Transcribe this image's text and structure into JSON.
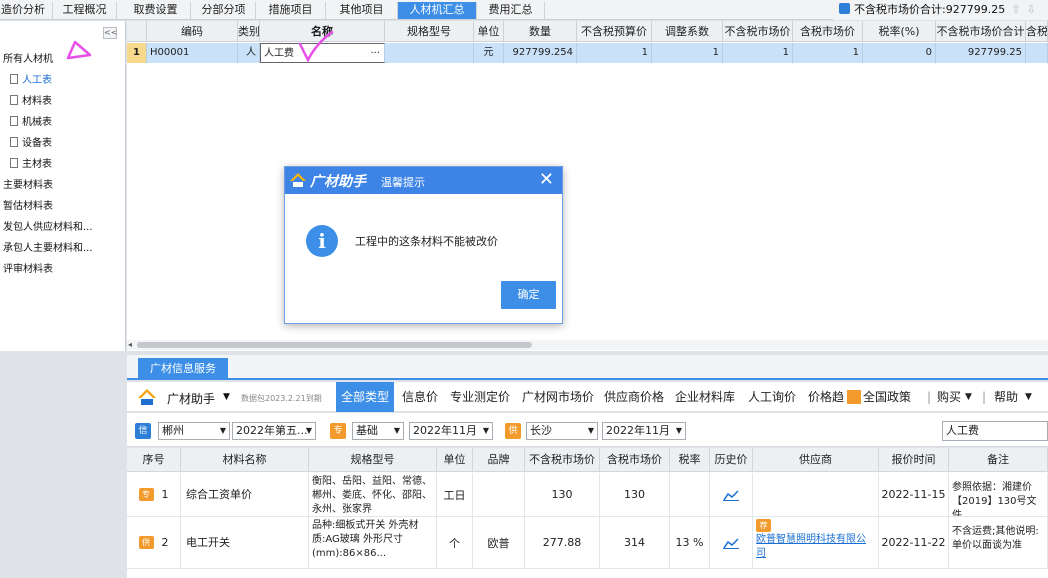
{
  "tabs": [
    {
      "label": "造价分析",
      "active": false
    },
    {
      "label": "工程概况",
      "active": false
    },
    {
      "label": "取费设置",
      "active": false
    },
    {
      "label": "分部分项",
      "active": false
    },
    {
      "label": "措施项目",
      "active": false
    },
    {
      "label": "其他项目",
      "active": false
    },
    {
      "label": "人材机汇总",
      "active": true
    },
    {
      "label": "费用汇总",
      "active": false
    }
  ],
  "total": {
    "label": "不含税市场价合计:927799.25"
  },
  "sidebar": {
    "collapse_label": "<<",
    "items": [
      {
        "label": "所有人材机",
        "level": 0
      },
      {
        "label": "人工表",
        "level": 1,
        "selected": true
      },
      {
        "label": "材料表",
        "level": 1
      },
      {
        "label": "机械表",
        "level": 1
      },
      {
        "label": "设备表",
        "level": 1
      },
      {
        "label": "主材表",
        "level": 1
      },
      {
        "label": "主要材料表",
        "level": 0
      },
      {
        "label": "暂估材料表",
        "level": 0
      },
      {
        "label": "发包人供应材料和...",
        "level": 0
      },
      {
        "label": "承包人主要材料和...",
        "level": 0
      },
      {
        "label": "评审材料表",
        "level": 0
      }
    ]
  },
  "grid": {
    "columns": [
      "编码",
      "类别",
      "名称",
      "规格型号",
      "单位",
      "数量",
      "不含税预算价",
      "调整系数",
      "不含税市场价",
      "含税市场价",
      "税率(%)",
      "不含税市场价合计",
      "含税"
    ],
    "row": {
      "index": "1",
      "code": "H00001",
      "category": "人",
      "name": "人工费",
      "spec": "",
      "unit": "元",
      "quantity": "927799.254",
      "budget_price": "1",
      "adjust_factor": "1",
      "market_price_ex_tax": "1",
      "market_price_in_tax": "1",
      "tax_rate": "0",
      "total_ex_tax": "927799.25"
    }
  },
  "dialog": {
    "brand": "广材助手",
    "title": "温馨提示",
    "close": "✕",
    "icon": "i",
    "message": "工程中的这条材料不能被改价",
    "ok_label": "确定"
  },
  "service": {
    "tab_label": "广材信息服务",
    "brand": "广材助手",
    "version_note": "数据包2023.2.21到期",
    "menu": [
      "全部类型",
      "信息价",
      "专业测定价",
      "广材网市场价",
      "供应商价格",
      "企业材料库",
      "人工询价",
      "价格趋",
      "全国政策",
      "|",
      "购买",
      "|",
      "帮助"
    ],
    "filters": {
      "badge_info": "信",
      "region": "郴州",
      "period": "2022年第五...",
      "badge_pro": "专",
      "pro_type": "基础",
      "pro_month": "2022年11月",
      "badge_supply": "供",
      "supply_city": "长沙",
      "supply_month": "2022年11月",
      "search_value": "人工费"
    },
    "table": {
      "headers": [
        "序号",
        "材料名称",
        "规格型号",
        "单位",
        "品牌",
        "不含税市场价",
        "含税市场价",
        "税率",
        "历史价",
        "供应商",
        "报价时间",
        "备注"
      ],
      "rows": [
        {
          "tag": "专",
          "index": "1",
          "name": "综合工资单价",
          "spec": "衡阳、岳阳、益阳、常德、郴州、娄底、怀化、邵阳、永州、张家界",
          "unit": "工日",
          "brand": "",
          "price_ex": "130",
          "price_in": "130",
          "tax": "",
          "supplier": "",
          "supplier_tag": "",
          "date": "2022-11-15",
          "note": "参照依据：湘建价【2019】130号文件"
        },
        {
          "tag": "供",
          "index": "2",
          "name": "电工开关",
          "spec": "品种:细板式开关 外壳材质:AG玻璃 外形尺寸(mm):86×86...",
          "unit": "个",
          "brand": "欧普",
          "price_ex": "277.88",
          "price_in": "314",
          "tax": "13 %",
          "supplier": "欧普智慧照明科技有限公司",
          "supplier_tag": "荐",
          "date": "2022-11-22",
          "note": "不含运费;其他说明:单价以面谈为准"
        }
      ]
    }
  },
  "colors": {
    "accent": "#3c8ee6",
    "selected_row": "#c9e1f9",
    "annotation": "#e84ee8"
  }
}
